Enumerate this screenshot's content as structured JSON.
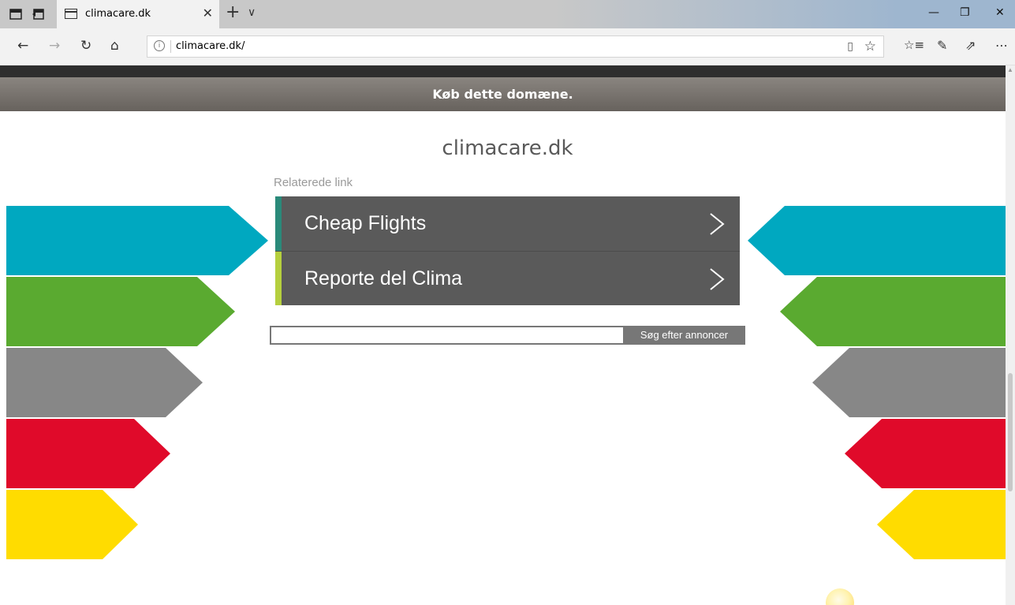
{
  "browser": {
    "tab_title": "climacare.dk",
    "url": "climacare.dk/",
    "icons": {
      "tab_actions": [
        "tabs-aside-icon",
        "restore-tabs-icon"
      ],
      "nav": [
        "back-icon",
        "forward-icon",
        "refresh-icon",
        "home-icon"
      ],
      "toolbar": [
        "favorites-list-icon",
        "pen-icon",
        "share-icon",
        "more-icon"
      ],
      "window": [
        "minimize-icon",
        "restore-icon",
        "close-icon"
      ]
    }
  },
  "banner": {
    "text": "Køb dette domæne."
  },
  "page": {
    "domain_title": "climacare.dk",
    "related_label": "Relaterede link",
    "links": [
      {
        "label": "Cheap Flights",
        "accent": "#2a8a7a"
      },
      {
        "label": "Reporte del Clima",
        "accent": "#b5cf3e"
      }
    ],
    "search": {
      "value": "",
      "button_label": "Søg efter annoncer"
    }
  },
  "colors": {
    "arrow_cyan": "#00a8c0",
    "arrow_green": "#5aaa30",
    "arrow_gray": "#878787",
    "arrow_red": "#e00a2a",
    "arrow_yellow": "#ffdc00",
    "link_bg": "#5a5a5a"
  }
}
